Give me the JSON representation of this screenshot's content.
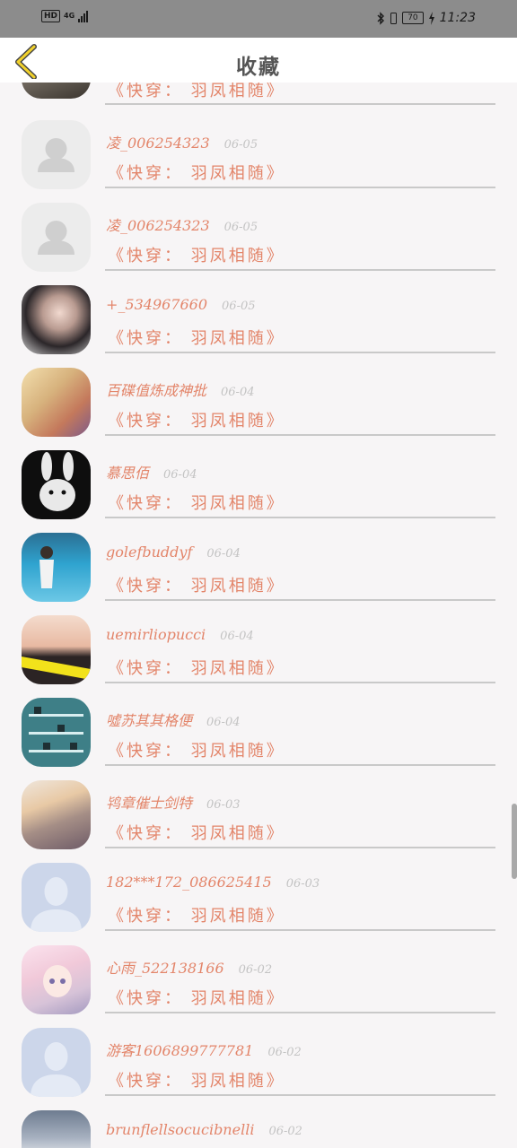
{
  "status_bar": {
    "hd": "HD",
    "network": "4G",
    "battery": "70",
    "time": "11:23"
  },
  "header": {
    "back_icon": "chevron-left-icon",
    "title": "收藏"
  },
  "items": [
    {
      "name": "",
      "date": "",
      "book": "《快穿： 羽凤相随》",
      "avatar": "photo-dark"
    },
    {
      "name": "凌_006254323",
      "date": "06-05",
      "book": "《快穿： 羽凤相随》",
      "avatar": "default-user"
    },
    {
      "name": "凌_006254323",
      "date": "06-05",
      "book": "《快穿： 羽凤相随》",
      "avatar": "default-user"
    },
    {
      "name": "+_534967660",
      "date": "06-05",
      "book": "《快穿： 羽凤相随》",
      "avatar": "photo-girl"
    },
    {
      "name": "百碟值炼成神批",
      "date": "06-04",
      "book": "《快穿： 羽凤相随》",
      "avatar": "photo-warm"
    },
    {
      "name": "慕思佰",
      "date": "06-04",
      "book": "《快穿： 羽凤相随》",
      "avatar": "photo-bunny"
    },
    {
      "name": "golefbuddyf",
      "date": "06-04",
      "book": "《快穿： 羽凤相随》",
      "avatar": "photo-blue"
    },
    {
      "name": "uemirliopucci",
      "date": "06-04",
      "book": "《快穿： 羽凤相随》",
      "avatar": "photo-yellow"
    },
    {
      "name": "噓苏其其格便",
      "date": "06-04",
      "book": "《快穿： 羽凤相随》",
      "avatar": "photo-teal"
    },
    {
      "name": "鸨章催士剑特",
      "date": "06-03",
      "book": "《快穿： 羽凤相随》",
      "avatar": "photo-blonde"
    },
    {
      "name": "182***172_086625415",
      "date": "06-03",
      "book": "《快穿： 羽凤相随》",
      "avatar": "default-blue"
    },
    {
      "name": "心雨_522138166",
      "date": "06-02",
      "book": "《快穿： 羽凤相随》",
      "avatar": "photo-anime"
    },
    {
      "name": "游客1606899777781",
      "date": "06-02",
      "book": "《快穿： 羽凤相随》",
      "avatar": "default-blue"
    },
    {
      "name": "brunflellsocucibnelli",
      "date": "06-02",
      "book": "",
      "avatar": "photo-landscape"
    }
  ]
}
